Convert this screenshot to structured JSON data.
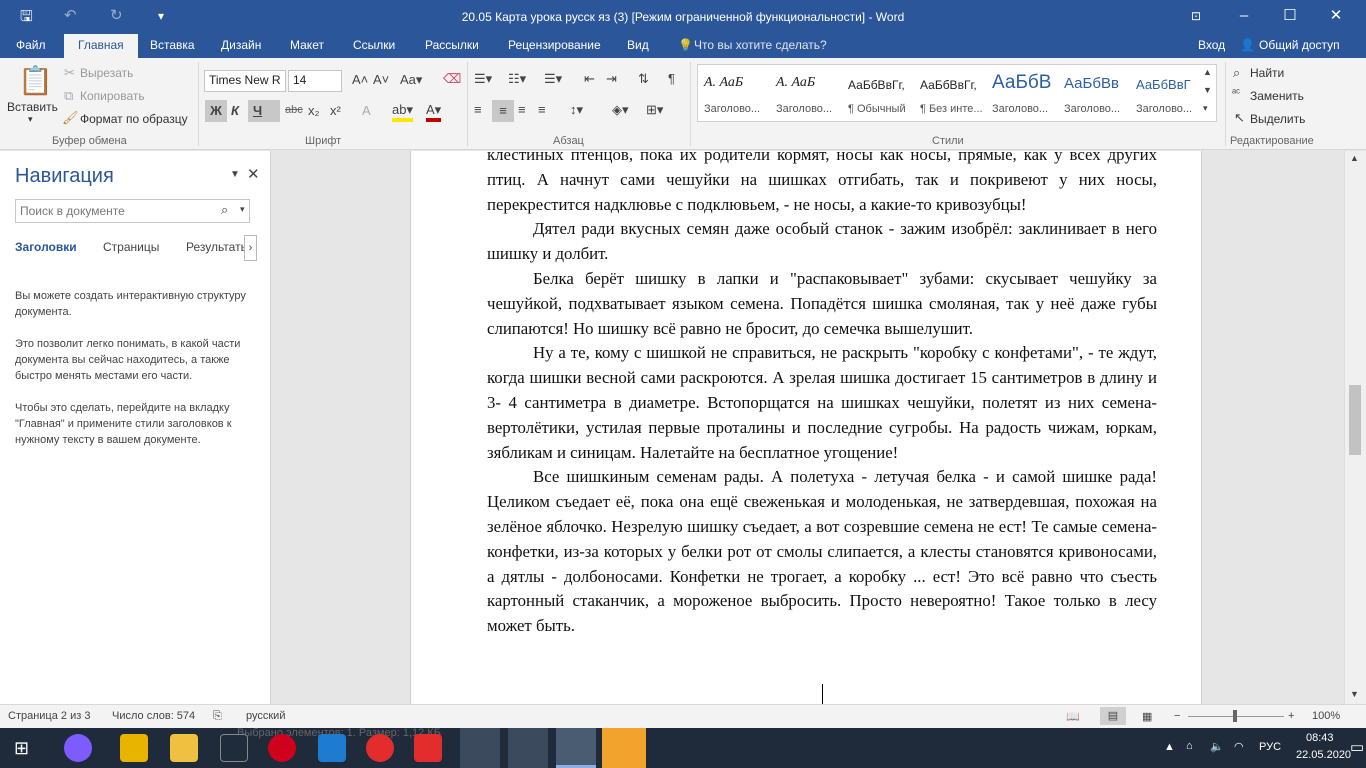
{
  "titlebar": {
    "title": "20.05 Карта урока русск яз  (3) [Режим ограниченной функциональности] - Word",
    "save_icon": "save-icon",
    "undo_icon": "undo-icon",
    "redo_icon": "redo-icon",
    "ribbon_options_icon": "ribbon-display-icon"
  },
  "tabs": {
    "file": "Файл",
    "home": "Главная",
    "insert": "Вставка",
    "design": "Дизайн",
    "layout": "Макет",
    "references": "Ссылки",
    "mailings": "Рассылки",
    "review": "Рецензирование",
    "view": "Вид",
    "tell_me": "Что вы хотите сделать?",
    "signin": "Вход",
    "share": "Общий доступ"
  },
  "ribbon": {
    "clipboard": {
      "paste": "Вставить",
      "cut": "Вырезать",
      "copy": "Копировать",
      "format_painter": "Формат по образцу",
      "label": "Буфер обмена"
    },
    "font": {
      "name": "Times New R",
      "size": "14",
      "bold": "Ж",
      "italic": "К",
      "underline": "Ч",
      "strike": "abc",
      "label": "Шрифт"
    },
    "paragraph": {
      "label": "Абзац"
    },
    "styles": {
      "label": "Стили",
      "items": [
        {
          "sample": "А.  АаБ",
          "name": "Заголово..."
        },
        {
          "sample": "А.  АаБ",
          "name": "Заголово..."
        },
        {
          "sample": "АаБбВвГг,",
          "name": "¶ Обычный"
        },
        {
          "sample": "АаБбВвГг,",
          "name": "¶ Без инте..."
        },
        {
          "sample": "АаБбВ",
          "name": "Заголово..."
        },
        {
          "sample": "АаБбВв",
          "name": "Заголово..."
        },
        {
          "sample": "АаБбВвГ",
          "name": "Заголово..."
        }
      ]
    },
    "editing": {
      "find": "Найти",
      "replace": "Заменить",
      "select": "Выделить",
      "label": "Редактирование"
    }
  },
  "nav": {
    "title": "Навигация",
    "search_placeholder": "Поиск в документе",
    "tabs": [
      "Заголовки",
      "Страницы",
      "Результать"
    ],
    "p1": "Вы можете создать интерактивную структуру документа.",
    "p2": "Это позволит легко понимать, в какой части документа вы сейчас находитесь, а также быстро менять местами его части.",
    "p3": "Чтобы это сделать, перейдите на вкладку \"Главная\" и примените стили заголовков к нужному тексту в вашем документе."
  },
  "document": {
    "paragraphs": [
      {
        "indent": false,
        "text": "клестиных птенцов, пока их родители кормят, носы как носы, прямые, как у всех других птиц. А начнут сами чешуйки на шишках отгибать, так и покривеют у них носы, перекрестится надклювье с подклювьем, - не носы, а какие-то кривозубцы!"
      },
      {
        "indent": true,
        "text": "Дятел ради вкусных семян даже особый станок - зажим изобрёл: заклинивает в него шишку и долбит."
      },
      {
        "indent": true,
        "text": "Белка берёт шишку в лапки и \"распаковывает\" зубами: скусывает чешуйку за чешуйкой, подхватывает языком семена. Попадётся шишка смоляная, так у неё даже губы слипаются! Но шишку всё равно не бросит, до семечка вышелушит."
      },
      {
        "indent": true,
        "text": "Ну а те, кому с шишкой не справиться, не раскрыть \"коробку с конфетами\", - те ждут, когда шишки весной сами раскроются. А зрелая шишка достигает 15 сантиметров в длину и 3- 4 сантиметра в диаметре. Встопорщатся на шишках чешуйки, полетят из них семена-вертолётики, устилая первые проталины и последние сугробы. На радость чижам, юркам, зябликам и синицам. Налетайте на бесплатное угощение!"
      },
      {
        "indent": true,
        "text": "Все шишкиным семенам рады. А полетуха - летучая белка - и самой шишке рада! Целиком съедает её, пока она ещё свеженькая и молоденькая, не затвердевшая, похожая на зелёное яблочко. Незрелую шишку съедает, а вот созревшие семена не ест! Те самые семена-конфетки, из-за которых у белки рот от смолы слипается, а клесты становятся кривоносами, а дятлы - долбоносами. Конфетки не трогает, а коробку ... ест! Это всё равно что съесть картонный стаканчик, а мороженое выбросить. Просто невероятно! Такое только в лесу может быть."
      }
    ]
  },
  "status": {
    "page": "Страница 2 из 3",
    "words": "Число слов: 574",
    "language": "русский",
    "zoom": "100%",
    "selection_hint": "Выбрано элементов: 1. Размер: 1,12 КБ"
  },
  "taskbar": {
    "lang": "РУС",
    "time": "08:43",
    "date": "22.05.2020"
  }
}
